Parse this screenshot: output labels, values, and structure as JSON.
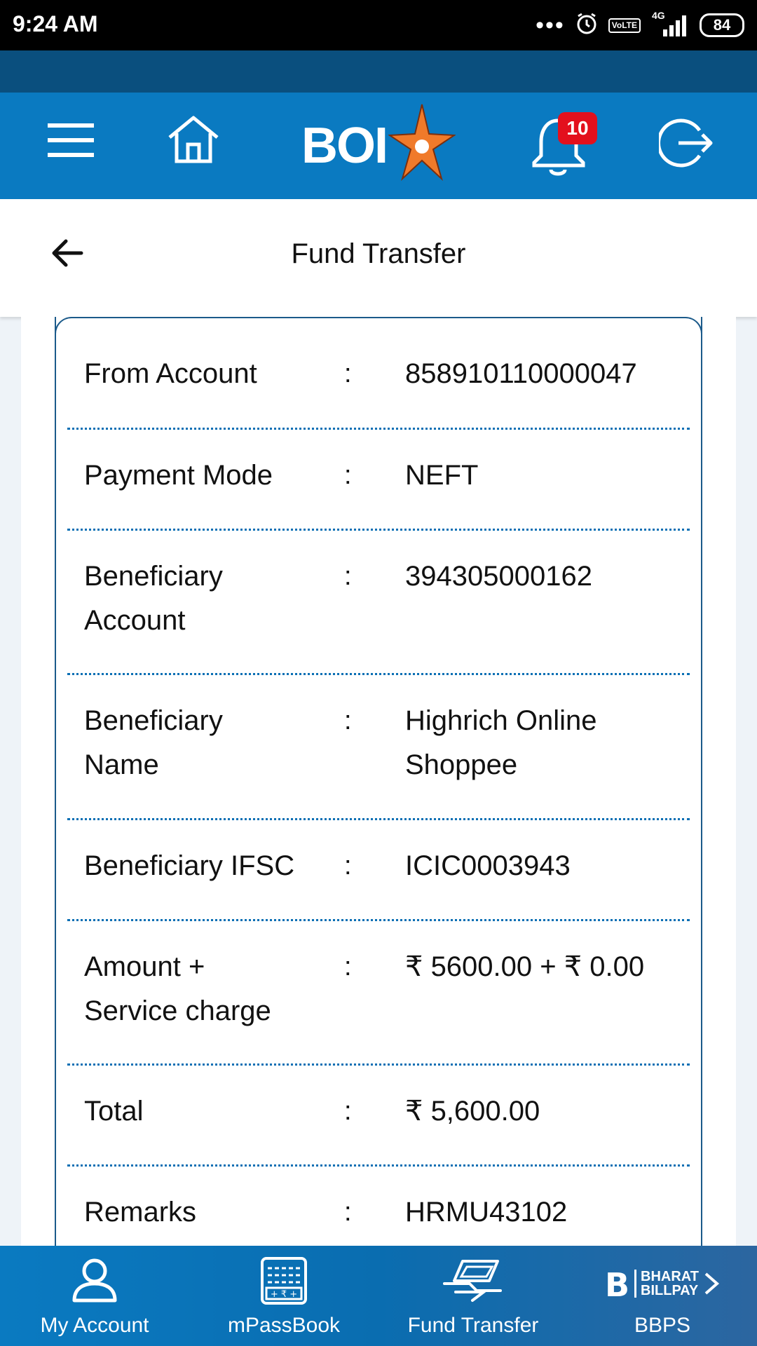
{
  "status_bar": {
    "time": "9:24 AM",
    "network": "4G",
    "volte": "VoLTE",
    "battery": "84"
  },
  "header": {
    "brand": "BOI",
    "notification_count": "10"
  },
  "page": {
    "title": "Fund Transfer"
  },
  "details": {
    "colon": ":",
    "rows": [
      {
        "label": "From Account",
        "value": "858910110000047"
      },
      {
        "label": "Payment Mode",
        "value": "NEFT"
      },
      {
        "label": "Beneficiary Account",
        "value": "394305000162"
      },
      {
        "label": "Beneficiary Name",
        "value": "Highrich Online Shoppee"
      },
      {
        "label": "Beneficiary IFSC",
        "value": "ICIC0003943"
      },
      {
        "label": "Amount + Service charge",
        "value": "₹ 5600.00 + ₹ 0.00"
      },
      {
        "label": "Total",
        "value": "₹ 5,600.00"
      },
      {
        "label": "Remarks",
        "value": "HRMU43102"
      }
    ]
  },
  "bottom_nav": {
    "items": [
      {
        "label": "My Account",
        "icon": "user-icon"
      },
      {
        "label": "mPassBook",
        "icon": "passbook-icon"
      },
      {
        "label": "Fund Transfer",
        "icon": "fund-transfer-icon"
      },
      {
        "label": "BBPS",
        "icon": "bharat-billpay-logo",
        "logo_text_1": "BHARAT",
        "logo_text_2": "BILLPAY"
      }
    ]
  },
  "colors": {
    "header_blue": "#0a7ac1",
    "stripe_blue": "#0a4f7e",
    "badge_red": "#e3101d",
    "star_orange": "#f07a2a"
  }
}
